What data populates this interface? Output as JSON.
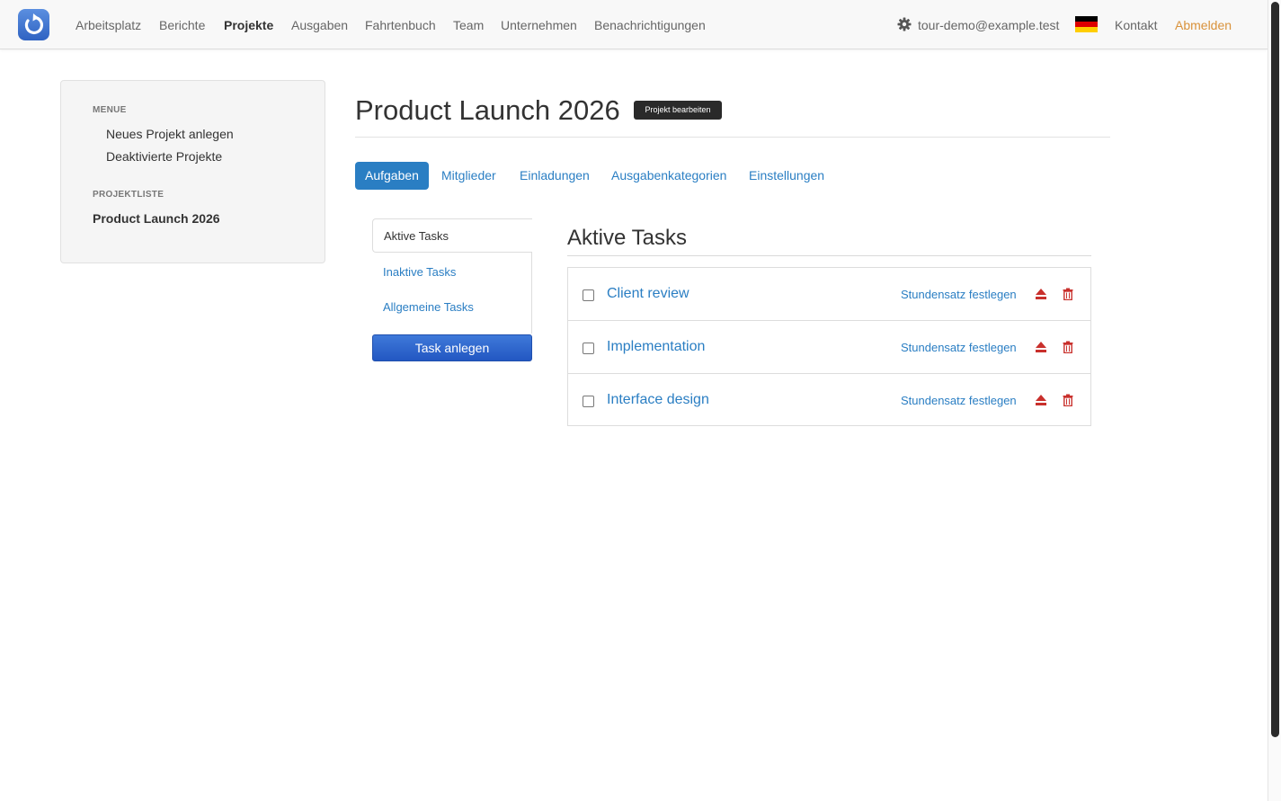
{
  "navbar": {
    "items": [
      {
        "label": "Arbeitsplatz"
      },
      {
        "label": "Berichte"
      },
      {
        "label": "Projekte"
      },
      {
        "label": "Ausgaben"
      },
      {
        "label": "Fahrtenbuch"
      },
      {
        "label": "Team"
      },
      {
        "label": "Unternehmen"
      },
      {
        "label": "Benachrichtigungen"
      }
    ],
    "active": "Projekte",
    "user_email": "tour-demo@example.test",
    "contact_label": "Kontakt",
    "logout_label": "Abmelden",
    "language_flag": "de-flag-icon"
  },
  "sidebar": {
    "menu_header": "MENUE",
    "menu_items": [
      {
        "label": "Neues Projekt anlegen"
      },
      {
        "label": "Deaktivierte Projekte"
      }
    ],
    "list_header": "PROJEKTLISTE",
    "projects": [
      {
        "label": "Product Launch 2026"
      }
    ]
  },
  "project": {
    "title": "Product Launch 2026",
    "edit_label": "Projekt bearbeiten"
  },
  "tabs": [
    {
      "label": "Aufgaben",
      "active": true
    },
    {
      "label": "Mitglieder"
    },
    {
      "label": "Einladungen"
    },
    {
      "label": "Ausgabenkategorien"
    },
    {
      "label": "Einstellungen"
    }
  ],
  "task_nav": {
    "items": [
      {
        "label": "Aktive Tasks",
        "active": true
      },
      {
        "label": "Inaktive Tasks"
      },
      {
        "label": "Allgemeine Tasks"
      }
    ],
    "create_label": "Task anlegen"
  },
  "tasks_section": {
    "title": "Aktive Tasks",
    "rows": [
      {
        "name": "Client review",
        "rate_label": "Stundensatz festlegen"
      },
      {
        "name": "Implementation",
        "rate_label": "Stundensatz festlegen"
      },
      {
        "name": "Interface design",
        "rate_label": "Stundensatz festlegen"
      }
    ]
  },
  "colors": {
    "accent": "#2a7ec3",
    "danger": "#d9534f",
    "logout": "#d9923b",
    "button_primary": "#2f63c2"
  }
}
